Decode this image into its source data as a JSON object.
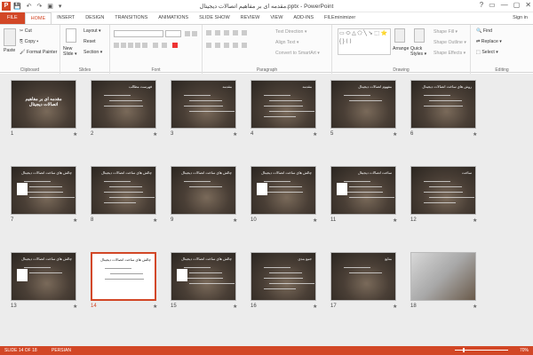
{
  "titlebar": {
    "app_icon": "P",
    "title": "مقدمه ای بر مفاهیم اتصالات دیجیتال.pptx - PowerPoint",
    "quick_access": "💾 ↶ ↷ ▣ ▾",
    "window_controls": [
      "?",
      "▭",
      "—",
      "▢",
      "✕"
    ]
  },
  "tabs": [
    "FILE",
    "HOME",
    "INSERT",
    "DESIGN",
    "TRANSITIONS",
    "ANIMATIONS",
    "SLIDE SHOW",
    "REVIEW",
    "VIEW",
    "ADD-INS",
    "FILEminimizer"
  ],
  "active_tab": "HOME",
  "signin": "Sign in",
  "ribbon": {
    "clipboard": {
      "label": "Clipboard",
      "paste": "Paste",
      "cut": "Cut",
      "copy": "Copy ▾",
      "format_painter": "Format Painter"
    },
    "slides": {
      "label": "Slides",
      "new_slide": "New Slide ▾",
      "layout": "Layout ▾",
      "reset": "Reset",
      "section": "Section ▾"
    },
    "font": {
      "label": "Font"
    },
    "paragraph": {
      "label": "Paragraph",
      "text_direction": "Text Direction ▾",
      "align_text": "Align Text ▾",
      "smartart": "Convert to SmartArt ▾"
    },
    "drawing": {
      "label": "Drawing",
      "arrange": "Arrange",
      "quick_styles": "Quick Styles ▾",
      "shape_fill": "Shape Fill ▾",
      "shape_outline": "Shape Outline ▾",
      "shape_effects": "Shape Effects ▾",
      "shapes_preview": "▭ ⬭ △ ⬠ ╲ ➘ ⬚ ⭐ { } ⟨ ⟩"
    },
    "editing": {
      "label": "Editing",
      "find": "Find",
      "replace": "Replace ▾",
      "select": "Select ▾"
    }
  },
  "slides": [
    {
      "num": "1",
      "title": "مقدمه ای بر مفاهیم اتصالات دیجیتال"
    },
    {
      "num": "2",
      "title": "فهرست مطالب"
    },
    {
      "num": "3",
      "title": "مقدمه"
    },
    {
      "num": "4",
      "title": "مقدمه"
    },
    {
      "num": "5",
      "title": "مفهوم اتصالات دیجیتال"
    },
    {
      "num": "6",
      "title": "روش های ساخت اتصالات دیجیتال"
    },
    {
      "num": "7",
      "title": "چالش های ساخت اتصالات دیجیتال"
    },
    {
      "num": "8",
      "title": "چالش های ساخت اتصالات دیجیتال"
    },
    {
      "num": "9",
      "title": "چالش های ساخت اتصالات دیجیتال"
    },
    {
      "num": "10",
      "title": "چالش های ساخت اتصالات دیجیتال"
    },
    {
      "num": "11",
      "title": "ساخت اتصالات دیجیتال"
    },
    {
      "num": "12",
      "title": "ساخت"
    },
    {
      "num": "13",
      "title": "چالش های ساخت اتصالات دیجیتال"
    },
    {
      "num": "14",
      "title": "چالش های ساخت اتصالات دیجیتال"
    },
    {
      "num": "15",
      "title": "چالش های ساخت اتصالات دیجیتال"
    },
    {
      "num": "16",
      "title": "جمع بندی"
    },
    {
      "num": "17",
      "title": "منابع"
    },
    {
      "num": "18",
      "title": ""
    }
  ],
  "selected_slide": "14",
  "star": "★",
  "status": {
    "slide_info": "SLIDE 14 OF 18",
    "language": "PERSIAN",
    "zoom": "70%",
    "zoom_level_percent": 70
  }
}
